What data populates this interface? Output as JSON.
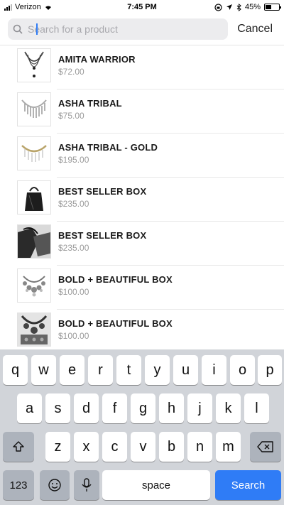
{
  "status_bar": {
    "carrier": "Verizon",
    "time": "7:45 PM",
    "battery": "45%",
    "battery_level": 0.45
  },
  "search": {
    "placeholder": "Search for a product",
    "cancel_label": "Cancel"
  },
  "products": [
    {
      "name": "AMITA WARRIOR",
      "price": "$72.00"
    },
    {
      "name": "ASHA TRIBAL",
      "price": "$75.00"
    },
    {
      "name": "ASHA TRIBAL - GOLD",
      "price": "$195.00"
    },
    {
      "name": "BEST SELLER BOX",
      "price": "$235.00"
    },
    {
      "name": "BEST SELLER BOX",
      "price": "$235.00"
    },
    {
      "name": "BOLD + BEAUTIFUL BOX",
      "price": "$100.00"
    },
    {
      "name": "BOLD + BEAUTIFUL BOX",
      "price": "$100.00"
    }
  ],
  "keyboard": {
    "row1": [
      "q",
      "w",
      "e",
      "r",
      "t",
      "y",
      "u",
      "i",
      "o",
      "p"
    ],
    "row2": [
      "a",
      "s",
      "d",
      "f",
      "g",
      "h",
      "j",
      "k",
      "l"
    ],
    "row3": [
      "z",
      "x",
      "c",
      "v",
      "b",
      "n",
      "m"
    ],
    "numbers_label": "123",
    "space_label": "space",
    "search_label": "Search"
  }
}
